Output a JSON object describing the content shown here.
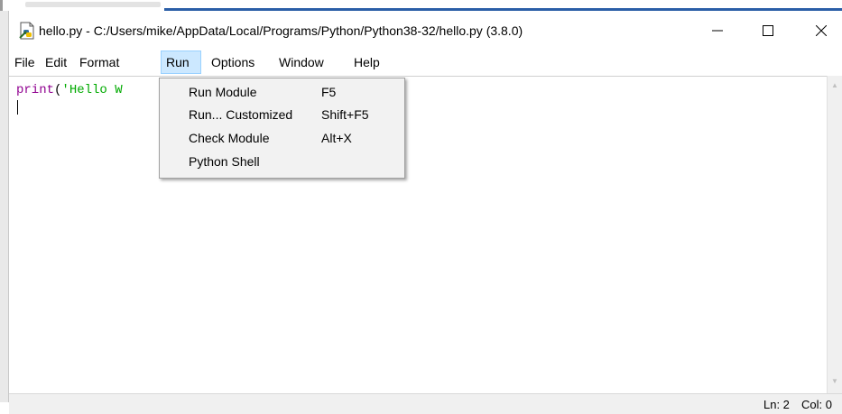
{
  "window": {
    "title": "hello.py - C:/Users/mike/AppData/Local/Programs/Python/Python38-32/hello.py (3.8.0)",
    "minimize_glyph": "—",
    "maximize_glyph": "☐",
    "close_glyph": "✕"
  },
  "menubar": {
    "items": [
      "File",
      "Edit",
      "Format",
      "Run",
      "Options",
      "Window",
      "Help"
    ],
    "active": "Run"
  },
  "editor": {
    "code_keyword": "print",
    "code_paren": "(",
    "code_string": "'Hello W"
  },
  "run_menu": {
    "items": [
      {
        "label": "Run Module",
        "shortcut": "F5"
      },
      {
        "label": "Run... Customized",
        "shortcut": "Shift+F5"
      },
      {
        "label": "Check Module",
        "shortcut": "Alt+X"
      },
      {
        "label": "Python Shell",
        "shortcut": ""
      }
    ]
  },
  "statusbar": {
    "line": "Ln: 2",
    "col": "Col: 0"
  },
  "colors": {
    "keyword": "#900090",
    "string": "#00aa00",
    "menu_active_bg": "#cce8ff",
    "dropdown_bg": "#f2f2f2"
  },
  "icons": {
    "app": "python-idle-file-icon",
    "minimize": "minimize-icon",
    "maximize": "maximize-icon",
    "close": "close-icon"
  }
}
